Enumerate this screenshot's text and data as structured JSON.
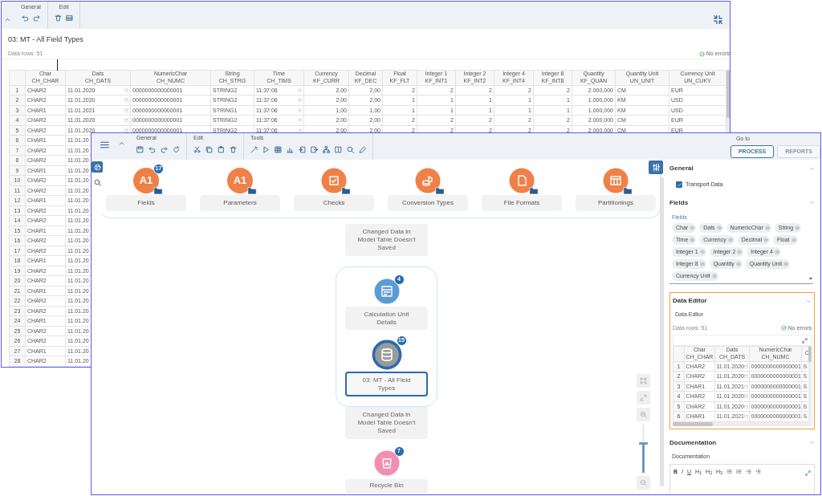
{
  "back_window": {
    "toolbar": [
      {
        "label": "General"
      },
      {
        "label": "Edit"
      }
    ],
    "title": "03: MT - All Field Types",
    "data_rows": "Data rows: 51",
    "status": "No errors",
    "table": {
      "columns": [
        {
          "label": "Char",
          "field": "CH_CHAR",
          "kind": "text"
        },
        {
          "label": "Dats",
          "field": "CH_DATS",
          "kind": "date"
        },
        {
          "label": "NumericChar",
          "field": "CH_NUMC",
          "kind": "text"
        },
        {
          "label": "String",
          "field": "CH_STRG",
          "kind": "text"
        },
        {
          "label": "Time",
          "field": "CH_TIMS",
          "kind": "time"
        },
        {
          "label": "Currency",
          "field": "KF_CURR",
          "kind": "number"
        },
        {
          "label": "Decimal",
          "field": "KF_DEC",
          "kind": "number"
        },
        {
          "label": "Float",
          "field": "KF_FLT",
          "kind": "number"
        },
        {
          "label": "Integer 1",
          "field": "KF_INT1",
          "kind": "number"
        },
        {
          "label": "Integer 2",
          "field": "KF_INT2",
          "kind": "number"
        },
        {
          "label": "Integer 4",
          "field": "KF_INT4",
          "kind": "number"
        },
        {
          "label": "Integer 8",
          "field": "KF_INT8",
          "kind": "number"
        },
        {
          "label": "Quantity",
          "field": "KF_QUAN",
          "kind": "number"
        },
        {
          "label": "Quantity Unit",
          "field": "UN_UNIT",
          "kind": "text"
        },
        {
          "label": "Currency Unit",
          "field": "UN_CUKY",
          "kind": "text"
        }
      ],
      "rows": [
        {
          "number": "1",
          "cells": [
            "CHAR2",
            "11.01.2020",
            "0000000000000001",
            "STRING2",
            "11:37:06",
            "2,00",
            "2,00",
            "2",
            "2",
            "2",
            "2",
            "2",
            "2.000,000",
            "CM",
            "EUR"
          ]
        },
        {
          "number": "2",
          "cells": [
            "CHAR2",
            "11.01.2020",
            "0000000000000001",
            "STRING2",
            "11:37:06",
            "2,00",
            "2,00",
            "1",
            "1",
            "1",
            "1",
            "1",
            "1.000,000",
            "KM",
            "USD"
          ]
        },
        {
          "number": "3",
          "cells": [
            "CHAR1",
            "11.01.2021",
            "0000000000000001",
            "STRING1",
            "11:37:06",
            "1,00",
            "1,00",
            "1",
            "1",
            "1",
            "1",
            "1",
            "1.000,000",
            "KM",
            "USD"
          ]
        },
        {
          "number": "4",
          "cells": [
            "CHAR2",
            "11.01.2020",
            "0000000000000001",
            "STRING2",
            "11:37:06",
            "2,00",
            "2,00",
            "2",
            "2",
            "2",
            "2",
            "2",
            "2.000,000",
            "CM",
            "EUR"
          ]
        },
        {
          "number": "5",
          "cells": [
            "CHAR2",
            "11.01.2020",
            "0000000000000001",
            "STRING2",
            "11:37:06",
            "2,00",
            "2,00",
            "2",
            "2",
            "2",
            "2",
            "2",
            "2.000,000",
            "CM",
            "EUR"
          ]
        },
        {
          "number": "6",
          "cells": [
            "CHAR1",
            "11.01.20"
          ]
        },
        {
          "number": "7",
          "cells": [
            "CHAR2",
            "11.01.20"
          ]
        },
        {
          "number": "8",
          "cells": [
            "CHAR2",
            "11.01.20"
          ]
        },
        {
          "number": "9",
          "cells": [
            "CHAR1",
            "11.01.20"
          ]
        },
        {
          "number": "10",
          "cells": [
            "CHAR2",
            "11.01.20"
          ]
        },
        {
          "number": "11",
          "cells": [
            "CHAR2",
            "11.01.20"
          ]
        },
        {
          "number": "12",
          "cells": [
            "CHAR1",
            "11.01.20"
          ]
        },
        {
          "number": "13",
          "cells": [
            "CHAR2",
            "11.01.20"
          ]
        },
        {
          "number": "14",
          "cells": [
            "CHAR2",
            "11.01.20"
          ]
        },
        {
          "number": "15",
          "cells": [
            "CHAR1",
            "11.01.20"
          ]
        },
        {
          "number": "16",
          "cells": [
            "CHAR2",
            "11.01.20"
          ]
        },
        {
          "number": "17",
          "cells": [
            "CHAR2",
            "11.01.20"
          ]
        },
        {
          "number": "18",
          "cells": [
            "CHAR1",
            "11.01.20"
          ]
        },
        {
          "number": "19",
          "cells": [
            "CHAR2",
            "11.01.20"
          ]
        },
        {
          "number": "20",
          "cells": [
            "CHAR2",
            "11.01.20"
          ]
        },
        {
          "number": "21",
          "cells": [
            "CHAR1",
            "11.01.20"
          ]
        },
        {
          "number": "22",
          "cells": [
            "CHAR2",
            "11.01.20"
          ]
        },
        {
          "number": "23",
          "cells": [
            "CHAR2",
            "11.01.20"
          ]
        },
        {
          "number": "24",
          "cells": [
            "CHAR1",
            "11.01.20"
          ]
        },
        {
          "number": "25",
          "cells": [
            "CHAR2",
            "11.01.20"
          ]
        },
        {
          "number": "26",
          "cells": [
            "CHAR2",
            "11.01.20"
          ]
        },
        {
          "number": "27",
          "cells": [
            "CHAR1",
            "11.01.20"
          ]
        },
        {
          "number": "28",
          "cells": [
            "CHAR2",
            "11.01.20"
          ]
        }
      ]
    }
  },
  "front_window": {
    "toolbar": [
      {
        "label": "General"
      },
      {
        "label": "Edit"
      },
      {
        "label": "Tools"
      }
    ],
    "go_to": {
      "label": "Go to",
      "buttons": [
        {
          "label": "PROCESS",
          "disabled": false
        },
        {
          "label": "REPORTS",
          "disabled": true
        }
      ]
    },
    "tiles": [
      {
        "label": "Fields",
        "kind": "glyph",
        "glyph": "A1",
        "badge": "17"
      },
      {
        "label": "Parameters",
        "kind": "glyph",
        "glyph": "A1"
      },
      {
        "label": "Checks",
        "kind": "check"
      },
      {
        "label": "Conversion Types",
        "kind": "coins"
      },
      {
        "label": "File Formats",
        "kind": "file"
      },
      {
        "label": "Partitionings",
        "kind": "layout"
      }
    ],
    "nodes": [
      {
        "kind": "note",
        "label": "Changed Data in Model Table Doesn't Saved",
        "selected": false
      },
      {
        "kind": "group",
        "selected": false,
        "children": [
          {
            "kind": "calc",
            "label": "Calculation Unit Details",
            "badge": "4",
            "selected": false
          },
          {
            "kind": "table",
            "label": "03: MT - All Field Types",
            "badge": "15",
            "selected": true
          }
        ]
      },
      {
        "kind": "note",
        "label": "Changed Data in Model Table Doesn't Saved",
        "selected": false
      },
      {
        "kind": "recycle",
        "label": "Recycle Bin",
        "badge": "7",
        "selected": false
      }
    ],
    "zoom": {
      "level": 0.6
    },
    "panel": {
      "sections": [
        {
          "title": "General",
          "kind": "checkbox",
          "highlighted": false,
          "checkbox": {
            "label": "Transport Data",
            "checked": true
          }
        },
        {
          "title": "Fields",
          "kind": "tokens",
          "highlighted": false,
          "field_label": "Fields",
          "tokens": [
            "Char",
            "Dats",
            "NumericChar",
            "String",
            "Time",
            "Currency",
            "Decimal",
            "Float",
            "Integer 1",
            "Integer 2",
            "Integer 4",
            "Integer 8",
            "Quantity",
            "Quantity Unit",
            "Currency Unit"
          ]
        },
        {
          "title": "Data Editor",
          "kind": "table",
          "highlighted": true,
          "field_label": "Data Editor",
          "data_rows": "Data rows: 51",
          "status": "No errors",
          "table": {
            "columns": [
              {
                "label": "Char",
                "field": "CH_CHAR",
                "kind": "text"
              },
              {
                "label": "Dats",
                "field": "CH_DATS",
                "kind": "date"
              },
              {
                "label": "NumericChar",
                "field": "CH_NUMC",
                "kind": "text"
              },
              {
                "field": "C",
                "kind": "text"
              }
            ],
            "rows": [
              {
                "number": "1",
                "cells": [
                  "CHAR2",
                  "11.01.2020",
                  "0000000000000001",
                  "S"
                ]
              },
              {
                "number": "2",
                "cells": [
                  "CHAR2",
                  "11.01.2020",
                  "0000000000000001",
                  "S"
                ]
              },
              {
                "number": "3",
                "cells": [
                  "CHAR1",
                  "11.01.2021",
                  "0000000000000001",
                  "S"
                ]
              },
              {
                "number": "4",
                "cells": [
                  "CHAR2",
                  "11.01.2020",
                  "0000000000000001",
                  "S"
                ]
              },
              {
                "number": "5",
                "cells": [
                  "CHAR2",
                  "11.01.2020",
                  "0000000000000001",
                  "S"
                ]
              },
              {
                "number": "6",
                "cells": [
                  "CHAR1",
                  "11.01.2021",
                  "0000000000000001",
                  "S"
                ]
              }
            ]
          }
        },
        {
          "title": "Documentation",
          "kind": "editor",
          "highlighted": false,
          "field_label": "Documentation",
          "format_buttons": [
            {
              "label": "B",
              "kind": "bold"
            },
            {
              "label": "I",
              "kind": "italic"
            },
            {
              "label": "U",
              "kind": "underline"
            },
            {
              "label": "H$_{1}$",
              "kind": "plain"
            },
            {
              "label": "H$_{2}$",
              "kind": "plain"
            },
            {
              "label": "H$_{3}$",
              "kind": "plain"
            }
          ]
        }
      ]
    }
  }
}
